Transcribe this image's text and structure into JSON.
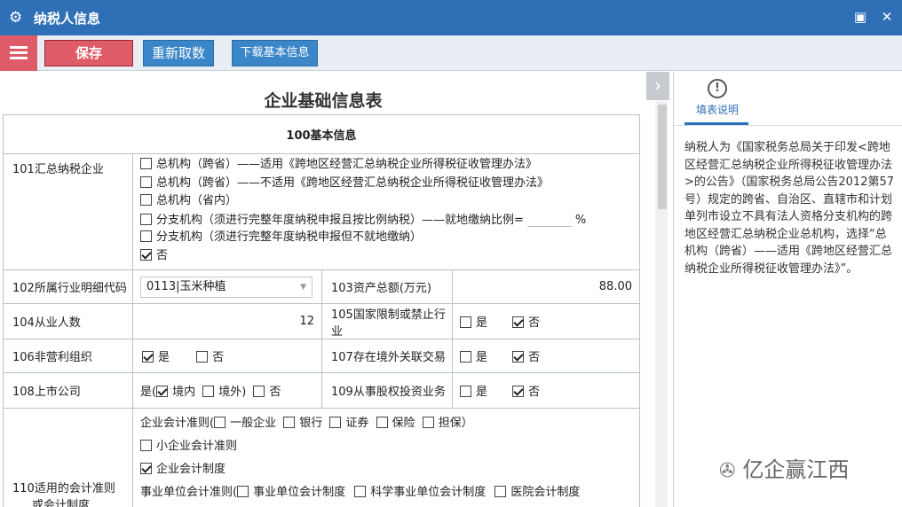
{
  "window": {
    "title": "纳税人信息",
    "gear_icon": "⚙",
    "restore_icon": "▣",
    "close_icon": "✕"
  },
  "toolbar": {
    "save_label": "保存",
    "refetch_label": "重新取数",
    "download_label": "下载基本信息"
  },
  "form": {
    "title": "企业基础信息表",
    "section_title": "100基本信息",
    "row101": {
      "label": "101汇总纳税企业",
      "options": [
        {
          "text": "总机构（跨省）——适用《跨地区经营汇总纳税企业所得税征收管理办法》",
          "checked": false
        },
        {
          "text": "总机构（跨省）——不适用《跨地区经营汇总纳税企业所得税征收管理办法》",
          "checked": false
        },
        {
          "text": "总机构（省内）",
          "checked": false
        },
        {
          "text": "分支机构（须进行完整年度纳税申报且按比例纳税）——就地缴纳比例=",
          "checked": false
        },
        {
          "text": "分支机构（须进行完整年度纳税申报但不就地缴纳）",
          "checked": false
        },
        {
          "text": "否",
          "checked": true
        }
      ],
      "percent_unit": "%"
    },
    "row102": {
      "label": "102所属行业明细代码",
      "value": "0113|玉米种植",
      "label2": "103资产总额(万元)",
      "value2": "88.00"
    },
    "row104": {
      "label": "104从业人数",
      "value": "12",
      "label2": "105国家限制或禁止行业",
      "yes": "是",
      "no": "否",
      "yes_checked": false,
      "no_checked": true
    },
    "row106": {
      "label": "106非营利组织",
      "yes": "是",
      "no": "否",
      "yes_checked": true,
      "no_checked": false,
      "label2": "107存在境外关联交易",
      "yes2": "是",
      "no2": "否",
      "yes2_checked": false,
      "no2_checked": true
    },
    "row108": {
      "label": "108上市公司",
      "prefix": "是(",
      "domestic": "境内",
      "overseas": "境外)",
      "no": "否",
      "domestic_checked": true,
      "overseas_checked": false,
      "no_checked": false,
      "label2": "109从事股权投资业务",
      "yes2": "是",
      "no2": "否",
      "yes2_checked": false,
      "no2_checked": true
    },
    "row110": {
      "label": "110适用的会计准则",
      "label_line2": "或会计制度",
      "enterprise_prefix": "企业会计准则(",
      "enterprise_opts": [
        "一般企业",
        "银行",
        "证券",
        "保险",
        "担保）"
      ],
      "small_enterprise": "小企业会计准则",
      "enterprise_system": "企业会计制度",
      "enterprise_system_checked": true,
      "public_prefix": "事业单位会计准则(",
      "public_opts": [
        "事业单位会计制度",
        "科学事业单位会计制度",
        "医院会计制度"
      ]
    }
  },
  "side": {
    "tab_label": "填表说明",
    "info_icon": "!",
    "text": "纳税人为《国家税务总局关于印发<跨地区经营汇总纳税企业所得税征收管理办法>的公告》（国家税务总局公告2012第57号）规定的跨省、自治区、直辖市和计划单列市设立不具有法人资格分支机构的跨地区经营汇总纳税企业总机构，选择“总机构（跨省）——适用《跨地区经营汇总纳税企业所得税征收管理办法》”。"
  },
  "watermark": {
    "text": "亿企赢江西",
    "icon": "✇"
  },
  "colors": {
    "titlebar": "#2f6fb6",
    "save": "#e05b68",
    "action": "#3b86c9"
  }
}
